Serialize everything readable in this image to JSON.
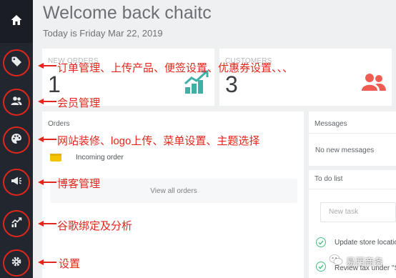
{
  "page": {
    "title": "Welcome back chaitc",
    "date": "Today is Friday Mar 22, 2019"
  },
  "sidebar": {
    "items": [
      {
        "icon": "home-icon"
      },
      {
        "icon": "tag-icon"
      },
      {
        "icon": "users-icon"
      },
      {
        "icon": "palette-icon"
      },
      {
        "icon": "megaphone-icon"
      },
      {
        "icon": "analytics-icon"
      },
      {
        "icon": "gear-icon"
      }
    ]
  },
  "cards": {
    "new_orders": {
      "label": "NEW ORDERS",
      "value": "1",
      "icon": "chart-up-icon"
    },
    "customers": {
      "label": "CUSTOMERS",
      "value": "3",
      "icon": "users-icon"
    }
  },
  "orders": {
    "title": "Orders",
    "item": "Incoming order",
    "view_all": "View all orders"
  },
  "messages": {
    "title": "Messages",
    "empty": "No new messages"
  },
  "todo": {
    "title": "To do list",
    "placeholder": "New task",
    "items": [
      "Update store locatio",
      "Review tax under \"S"
    ]
  },
  "annotations": [
    "订单管理、上传产品、便签设置、优惠券设置、、、",
    "会员管理",
    "网站装修、logo上传、菜单设置、主题选择",
    "博客管理",
    "谷歌绑定及分析",
    "设置"
  ],
  "watermark": "易西商务",
  "colors": {
    "sidebar": "#22262f",
    "annotation": "#e2261b",
    "chart_accent": "#3fb0a6",
    "customers_accent": "#ef5c52",
    "check": "#45c07f"
  }
}
